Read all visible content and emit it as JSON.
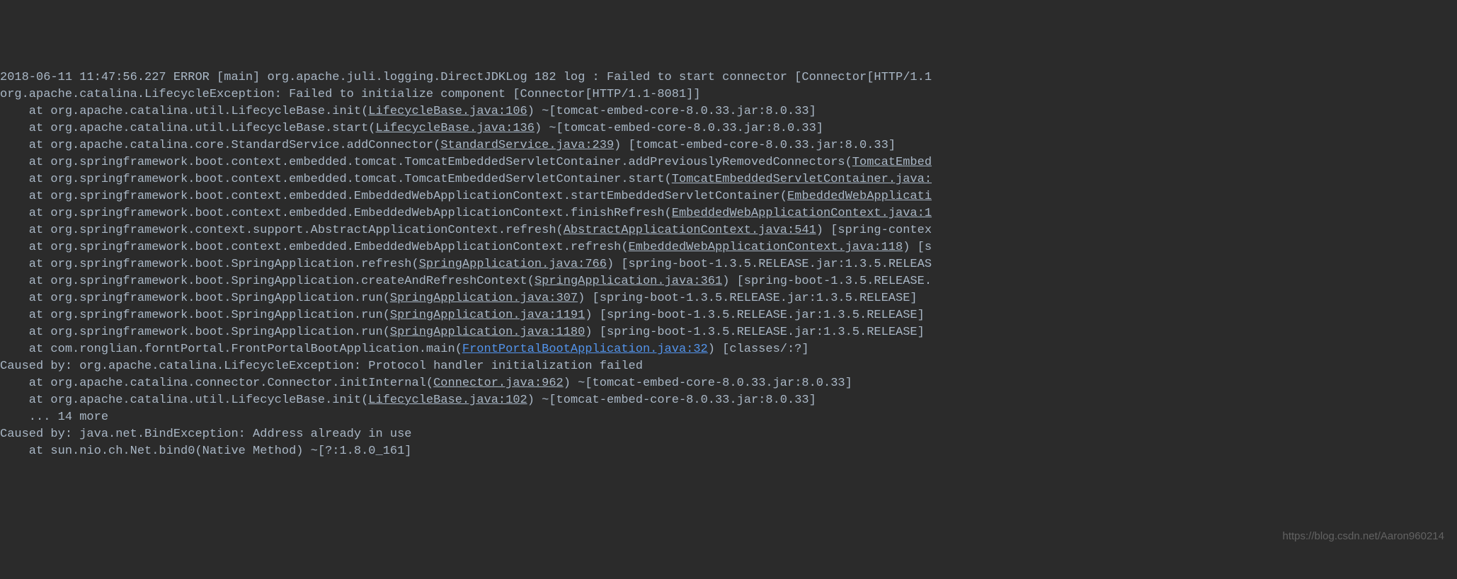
{
  "log": {
    "lines": [
      {
        "type": "plain",
        "text": "2018-06-11 11:47:56.227 ERROR [main] org.apache.juli.logging.DirectJDKLog 182 log : Failed to start connector [Connector[HTTP/1.1"
      },
      {
        "type": "plain",
        "text": "org.apache.catalina.LifecycleException: Failed to initialize component [Connector[HTTP/1.1-8081]]"
      },
      {
        "type": "stack",
        "prefix": "    at org.apache.catalina.util.LifecycleBase.init(",
        "link": "LifecycleBase.java:106",
        "linkClass": "link",
        "suffix": ") ~[tomcat-embed-core-8.0.33.jar:8.0.33]"
      },
      {
        "type": "stack",
        "prefix": "    at org.apache.catalina.util.LifecycleBase.start(",
        "link": "LifecycleBase.java:136",
        "linkClass": "link",
        "suffix": ") ~[tomcat-embed-core-8.0.33.jar:8.0.33]"
      },
      {
        "type": "stack",
        "prefix": "    at org.apache.catalina.core.StandardService.addConnector(",
        "link": "StandardService.java:239",
        "linkClass": "link",
        "suffix": ") [tomcat-embed-core-8.0.33.jar:8.0.33]"
      },
      {
        "type": "stack",
        "prefix": "    at org.springframework.boot.context.embedded.tomcat.TomcatEmbeddedServletContainer.addPreviouslyRemovedConnectors(",
        "link": "TomcatEmbed",
        "linkClass": "link",
        "suffix": ""
      },
      {
        "type": "stack",
        "prefix": "    at org.springframework.boot.context.embedded.tomcat.TomcatEmbeddedServletContainer.start(",
        "link": "TomcatEmbeddedServletContainer.java:",
        "linkClass": "link",
        "suffix": ""
      },
      {
        "type": "stack",
        "prefix": "    at org.springframework.boot.context.embedded.EmbeddedWebApplicationContext.startEmbeddedServletContainer(",
        "link": "EmbeddedWebApplicati",
        "linkClass": "link",
        "suffix": ""
      },
      {
        "type": "stack",
        "prefix": "    at org.springframework.boot.context.embedded.EmbeddedWebApplicationContext.finishRefresh(",
        "link": "EmbeddedWebApplicationContext.java:1",
        "linkClass": "link",
        "suffix": ""
      },
      {
        "type": "stack",
        "prefix": "    at org.springframework.context.support.AbstractApplicationContext.refresh(",
        "link": "AbstractApplicationContext.java:541",
        "linkClass": "link",
        "suffix": ") [spring-contex"
      },
      {
        "type": "stack",
        "prefix": "    at org.springframework.boot.context.embedded.EmbeddedWebApplicationContext.refresh(",
        "link": "EmbeddedWebApplicationContext.java:118",
        "linkClass": "link",
        "suffix": ") [s"
      },
      {
        "type": "stack",
        "prefix": "    at org.springframework.boot.SpringApplication.refresh(",
        "link": "SpringApplication.java:766",
        "linkClass": "link",
        "suffix": ") [spring-boot-1.3.5.RELEASE.jar:1.3.5.RELEAS"
      },
      {
        "type": "stack",
        "prefix": "    at org.springframework.boot.SpringApplication.createAndRefreshContext(",
        "link": "SpringApplication.java:361",
        "linkClass": "link",
        "suffix": ") [spring-boot-1.3.5.RELEASE."
      },
      {
        "type": "stack",
        "prefix": "    at org.springframework.boot.SpringApplication.run(",
        "link": "SpringApplication.java:307",
        "linkClass": "link",
        "suffix": ") [spring-boot-1.3.5.RELEASE.jar:1.3.5.RELEASE]"
      },
      {
        "type": "stack",
        "prefix": "    at org.springframework.boot.SpringApplication.run(",
        "link": "SpringApplication.java:1191",
        "linkClass": "link",
        "suffix": ") [spring-boot-1.3.5.RELEASE.jar:1.3.5.RELEASE]"
      },
      {
        "type": "stack",
        "prefix": "    at org.springframework.boot.SpringApplication.run(",
        "link": "SpringApplication.java:1180",
        "linkClass": "link",
        "suffix": ") [spring-boot-1.3.5.RELEASE.jar:1.3.5.RELEASE]"
      },
      {
        "type": "stack",
        "prefix": "    at com.ronglian.forntPortal.FrontPortalBootApplication.main(",
        "link": "FrontPortalBootApplication.java:32",
        "linkClass": "link-blue",
        "suffix": ") [classes/:?]"
      },
      {
        "type": "plain",
        "text": "Caused by: org.apache.catalina.LifecycleException: Protocol handler initialization failed"
      },
      {
        "type": "stack",
        "prefix": "    at org.apache.catalina.connector.Connector.initInternal(",
        "link": "Connector.java:962",
        "linkClass": "link",
        "suffix": ") ~[tomcat-embed-core-8.0.33.jar:8.0.33]"
      },
      {
        "type": "stack",
        "prefix": "    at org.apache.catalina.util.LifecycleBase.init(",
        "link": "LifecycleBase.java:102",
        "linkClass": "link",
        "suffix": ") ~[tomcat-embed-core-8.0.33.jar:8.0.33]"
      },
      {
        "type": "plain",
        "text": "    ... 14 more"
      },
      {
        "type": "plain",
        "text": "Caused by: java.net.BindException: Address already in use"
      },
      {
        "type": "plain",
        "text": "    at sun.nio.ch.Net.bind0(Native Method) ~[?:1.8.0_161]"
      }
    ]
  },
  "watermark": "https://blog.csdn.net/Aaron960214"
}
